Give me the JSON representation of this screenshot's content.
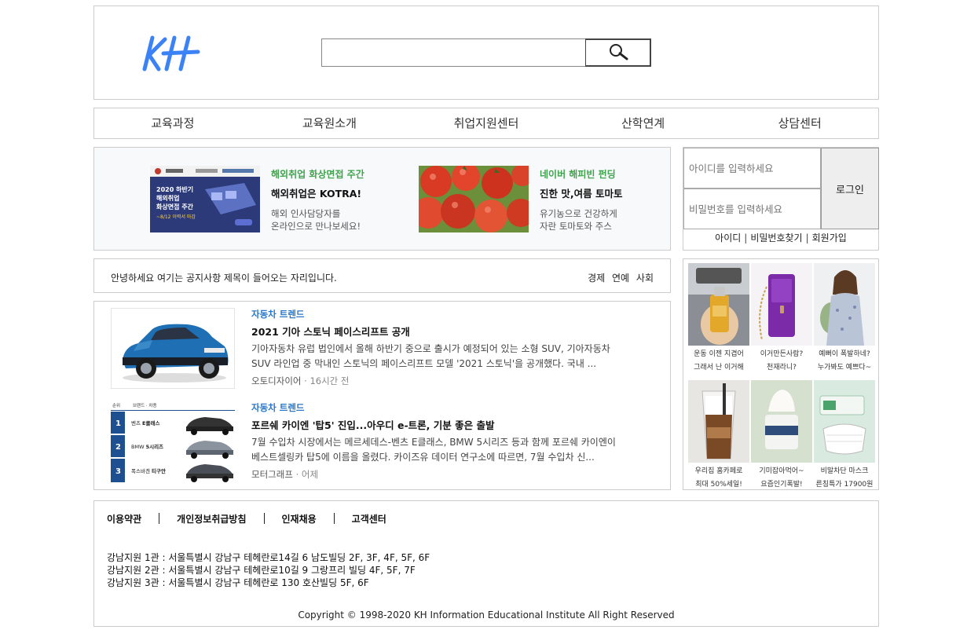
{
  "header": {
    "logo_text": "KH",
    "search": {
      "value": "",
      "placeholder": ""
    }
  },
  "nav": {
    "items": [
      "교육과정",
      "교육원소개",
      "취업지원센터",
      "산학연계",
      "상담센터"
    ]
  },
  "banners": [
    {
      "tag": "해외취업 화상면접 주간",
      "title": "해외취업은 KOTRA!",
      "desc1": "해외 인사담당자를",
      "desc2": "온라인으로 만나보세요!",
      "image_text": [
        "2020 하반기",
        "해외취업",
        "화상면접 주간",
        "~8/12 이력서 마감"
      ]
    },
    {
      "tag": "네이버 해피빈 펀딩",
      "title": "진한 맛,여름 토마토",
      "desc1": "유기농으로 건강하게",
      "desc2": "자란 토마토와 주스"
    }
  ],
  "login": {
    "id_placeholder": "아이디를 입력하세요",
    "pw_placeholder": "비밀번호를 입력하세요",
    "button": "로그인",
    "links": [
      "아이디",
      "비밀번호찾기",
      "회원가입"
    ]
  },
  "notice": {
    "text": "안녕하세요 여기는 공지사항 제목이 들어오는 자리입니다.",
    "categories": [
      "경제",
      "연예",
      "사회"
    ]
  },
  "news": [
    {
      "category": "자동차 트렌드",
      "title": "2021 기아 스토닉 페이스리프트 공개",
      "summary": "기아자동차 유럽 법인에서 올해 하반기 중으로 출시가 예정되어 있는 소형 SUV, 기아자동차 SUV 라인업 중 막내인 스토닉의 페이스리프트 모델 '2021 스토닉'을 공개했다. 국내 ...",
      "source": "오토디자이어",
      "age": "16시간 전"
    },
    {
      "category": "자동차 트렌드",
      "title": "포르쉐 카이엔 '탑5' 진입...아우디 e-트론, 기분 좋은 출발",
      "summary": "7월 수입차 시장에서는 메르세데스-벤츠 E클래스, BMW 5시리즈 등과 함께 포르쉐 카이엔이 베스트셀링카 탑5에 이름을 올렸다. 카이즈유 데이터 연구소에 따르면, 7월 수입차 신...",
      "source": "모터그래프",
      "age": "어제",
      "rank_table": {
        "headers": [
          "순위",
          "브랜드 · 차종"
        ],
        "rows": [
          {
            "rank": "1",
            "brand": "벤츠",
            "model": "E클래스"
          },
          {
            "rank": "2",
            "brand": "BMW",
            "model": "5시리즈"
          },
          {
            "rank": "3",
            "brand": "폭스바겐",
            "model": "티구안"
          }
        ]
      }
    }
  ],
  "ads": [
    {
      "line1": "운동 이젠 지겹어",
      "line2": "그래서 난 이거해",
      "icon": "perfume-bottle"
    },
    {
      "line1": "이거만든사람?",
      "line2": "천재라니?",
      "icon": "purple-wallet"
    },
    {
      "line1": "예뻐이 폭발하네?",
      "line2": "누가봐도 예쁘다~",
      "icon": "woman-floral-dress"
    },
    {
      "line1": "우리집 홈카페로",
      "line2": "최대 50%세일!",
      "icon": "iced-coffee"
    },
    {
      "line1": "기미잡아먹어~",
      "line2": "요즘인기폭발!",
      "icon": "cream-jar"
    },
    {
      "line1": "비말차단 마스크",
      "line2": "른칭특가 17900원",
      "icon": "face-mask"
    }
  ],
  "footer": {
    "links": [
      "이용약관",
      "개인정보취급방침",
      "인재채용",
      "고객센터"
    ],
    "addresses": [
      "강남지원 1관 : 서울특별시 강남구 테헤란로14길 6 남도빌딩 2F, 3F, 4F, 5F, 6F",
      "강남지원 2관 : 서울특별시 강남구 테헤란로10길 9 그랑프리 빌딩 4F, 5F, 7F",
      "강남지원 3관 : 서울특별시 강남구 테헤란로 130 호산빌딩 5F, 6F"
    ],
    "copyright": "Copyright © 1998-2020 KH Information Educational Institute All Right Reserved"
  },
  "colors": {
    "logo": "#3b82f6",
    "banner_tag": "#3fa34d",
    "news_category": "#2a78c8",
    "border": "#cccccc"
  }
}
